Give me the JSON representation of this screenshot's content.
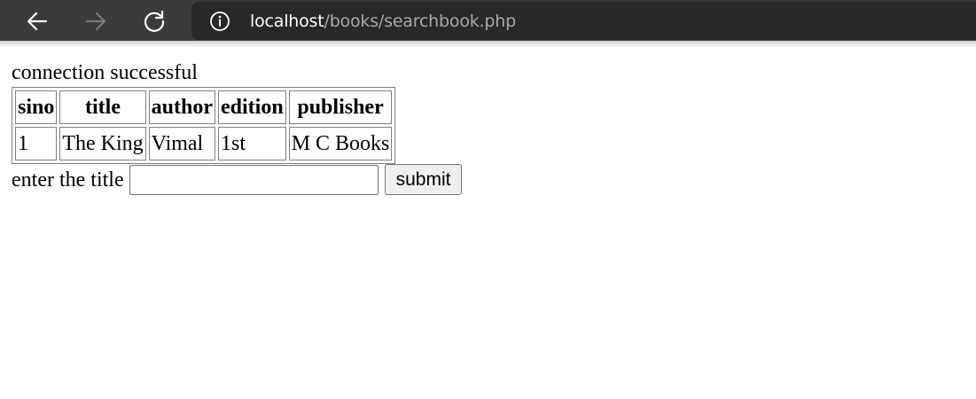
{
  "browser": {
    "address": {
      "host": "localhost",
      "path": "/books/searchbook.php"
    },
    "icons": {
      "back": "arrow-left-icon",
      "forward": "arrow-right-icon",
      "reload": "reload-icon",
      "info": "info-icon"
    },
    "colors": {
      "toolbar": "#3b3b3b",
      "address_bar": "#282828",
      "host_text": "#ffffff",
      "path_text": "#a9a9a9"
    }
  },
  "page": {
    "status": "connection successful",
    "table": {
      "headers": [
        "sino",
        "title",
        "author",
        "edition",
        "publisher"
      ],
      "rows": [
        [
          "1",
          "The King",
          "Vimal",
          "1st",
          "M C Books"
        ]
      ]
    },
    "search": {
      "label": "enter the title",
      "value": "",
      "submit_label": "submit"
    }
  }
}
